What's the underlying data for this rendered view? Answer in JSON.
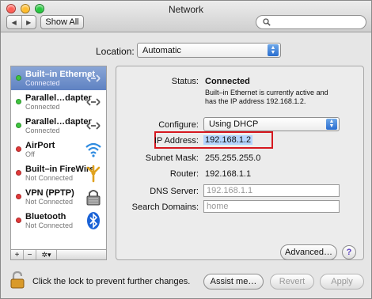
{
  "window": {
    "title": "Network"
  },
  "toolbar": {
    "back_glyph": "◀",
    "forward_glyph": "▶",
    "show_all_label": "Show All",
    "search": {
      "value": "",
      "placeholder": ""
    }
  },
  "location": {
    "label": "Location:",
    "value": "Automatic"
  },
  "services": [
    {
      "name": "Built–in Ethernet",
      "status": "Connected",
      "state": "green",
      "icon": "ethernet-icon"
    },
    {
      "name": "Parallel…dapter",
      "status": "Connected",
      "state": "green",
      "icon": "ethernet-icon"
    },
    {
      "name": "Parallel…dapter",
      "status": "Connected",
      "state": "green",
      "icon": "ethernet-icon"
    },
    {
      "name": "AirPort",
      "status": "Off",
      "state": "red",
      "icon": "wifi-icon"
    },
    {
      "name": "Built–in FireWire",
      "status": "Not Connected",
      "state": "red",
      "icon": "firewire-icon"
    },
    {
      "name": "VPN (PPTP)",
      "status": "Not Connected",
      "state": "red",
      "icon": "vpn-lock-icon"
    },
    {
      "name": "Bluetooth",
      "status": "Not Connected",
      "state": "red",
      "icon": "bluetooth-icon"
    }
  ],
  "sidebar_controls": {
    "add": "+",
    "remove": "−",
    "action": "✲▾"
  },
  "details": {
    "status_label": "Status:",
    "status_value": "Connected",
    "status_desc": "Built–in Ethernet is currently active and has the IP address 192.168.1.2.",
    "configure_label": "Configure:",
    "configure_value": "Using DHCP",
    "ip_label": "IP Address:",
    "ip_value": "192.168.1.2",
    "subnet_label": "Subnet Mask:",
    "subnet_value": "255.255.255.0",
    "router_label": "Router:",
    "router_value": "192.168.1.1",
    "dns_label": "DNS Server:",
    "dns_placeholder": "192.168.1.1",
    "search_domains_label": "Search Domains:",
    "search_domains_placeholder": "home"
  },
  "buttons": {
    "advanced": "Advanced…",
    "help": "?",
    "assist": "Assist me…",
    "revert": "Revert",
    "apply": "Apply"
  },
  "footer": {
    "lock_text": "Click the lock to prevent further changes."
  },
  "colors": {
    "selection": "#6f8fc9",
    "highlight_box": "#d6181f",
    "connected": "#3ec53e",
    "disconnected": "#e23838"
  }
}
